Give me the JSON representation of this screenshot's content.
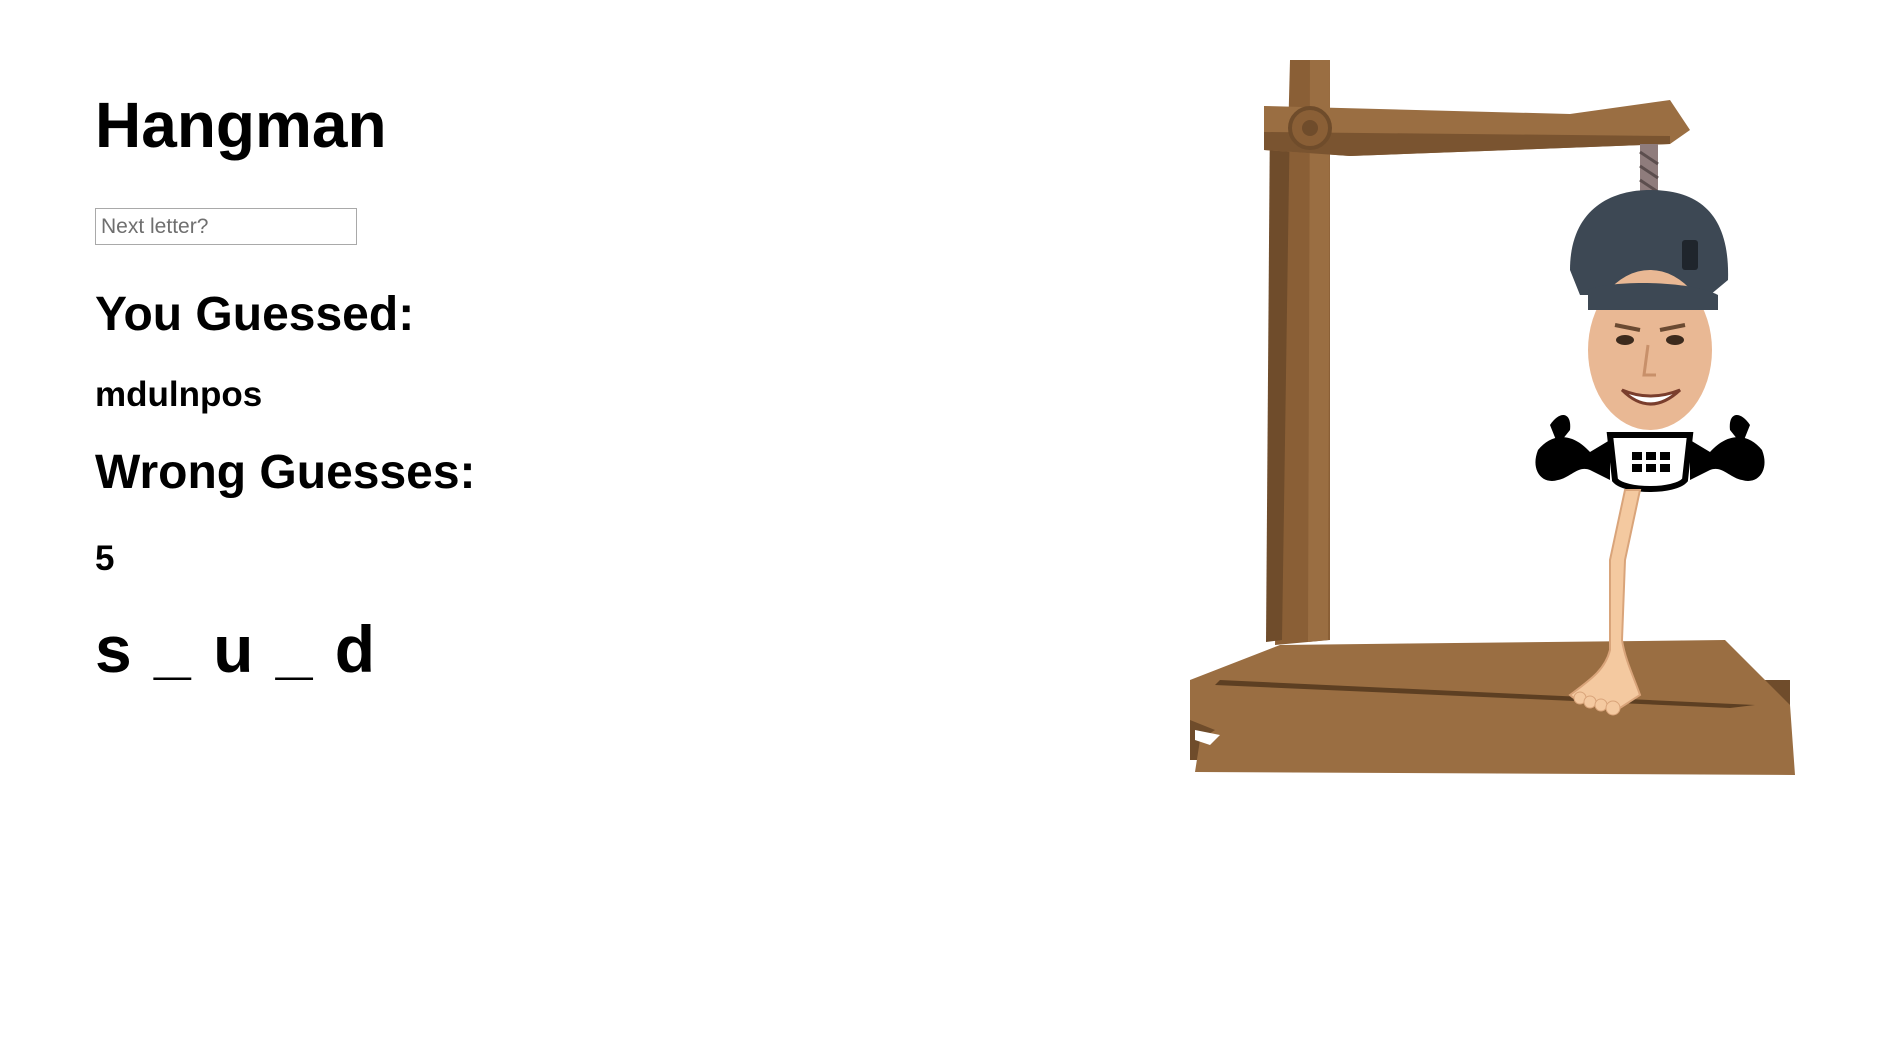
{
  "title": "Hangman",
  "input": {
    "placeholder": "Next letter?",
    "value": ""
  },
  "guessed": {
    "heading": "You Guessed:",
    "letters": "mdulnpos"
  },
  "wrong": {
    "heading": "Wrong Guesses:",
    "count": "5"
  },
  "word": {
    "display": "s _ u _ d"
  },
  "colors": {
    "wood_light": "#9a6e42",
    "wood_dark": "#6f4c2b",
    "rope": "#8f7c7c",
    "skin": "#f4c9a0",
    "beanie": "#3d4854"
  },
  "icons": {
    "figure": "hangman-figure-illustration"
  }
}
